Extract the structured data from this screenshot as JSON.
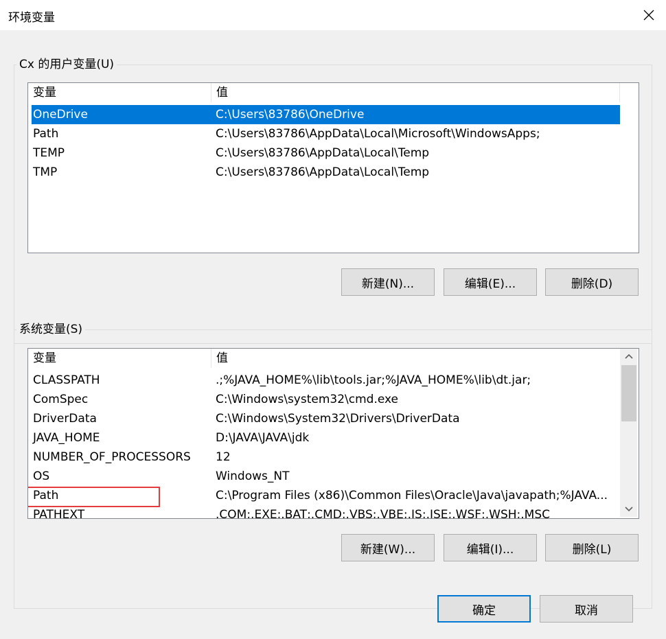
{
  "window": {
    "title": "环境变量"
  },
  "user_vars": {
    "group_label": "Cx 的用户变量(U)",
    "columns": [
      "变量",
      "值"
    ],
    "rows": [
      {
        "name": "OneDrive",
        "value": "C:\\Users\\83786\\OneDrive",
        "selected": true
      },
      {
        "name": "Path",
        "value": "C:\\Users\\83786\\AppData\\Local\\Microsoft\\WindowsApps;"
      },
      {
        "name": "TEMP",
        "value": "C:\\Users\\83786\\AppData\\Local\\Temp"
      },
      {
        "name": "TMP",
        "value": "C:\\Users\\83786\\AppData\\Local\\Temp"
      }
    ],
    "buttons": {
      "new": "新建(N)...",
      "edit": "编辑(E)...",
      "delete": "删除(D)"
    }
  },
  "system_vars": {
    "group_label": "系统变量(S)",
    "columns": [
      "变量",
      "值"
    ],
    "rows": [
      {
        "name": "CLASSPATH",
        "value": ".;%JAVA_HOME%\\lib\\tools.jar;%JAVA_HOME%\\lib\\dt.jar;"
      },
      {
        "name": "ComSpec",
        "value": "C:\\Windows\\system32\\cmd.exe"
      },
      {
        "name": "DriverData",
        "value": "C:\\Windows\\System32\\Drivers\\DriverData"
      },
      {
        "name": "JAVA_HOME",
        "value": "D:\\JAVA\\JAVA\\jdk"
      },
      {
        "name": "NUMBER_OF_PROCESSORS",
        "value": "12"
      },
      {
        "name": "OS",
        "value": "Windows_NT"
      },
      {
        "name": "Path",
        "value": "C:\\Program Files (x86)\\Common Files\\Oracle\\Java\\javapath;%JAVA...",
        "highlighted": true
      },
      {
        "name": "PATHEXT",
        "value": ".COM;.EXE;.BAT;.CMD;.VBS;.VBE;.JS;.JSE;.WSF;.WSH;.MSC"
      }
    ],
    "buttons": {
      "new": "新建(W)...",
      "edit": "编辑(I)...",
      "delete": "删除(L)"
    }
  },
  "footer": {
    "ok": "确定",
    "cancel": "取消"
  },
  "colors": {
    "selection": "#0078d7",
    "highlight_box": "#e33c3c",
    "dialog_bg": "#f0f0f0"
  },
  "icons": {
    "close": "close-icon",
    "scroll_up": "chevron-up-icon",
    "scroll_down": "chevron-down-icon"
  }
}
